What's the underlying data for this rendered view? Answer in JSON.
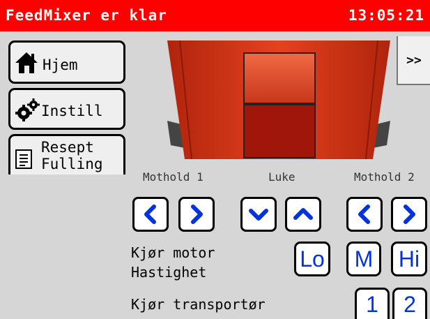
{
  "header": {
    "title": "FeedMixer er klar",
    "time": "13:05:21"
  },
  "sidebar": {
    "items": [
      {
        "label": "Hjem",
        "icon": "home-icon"
      },
      {
        "label": "Instill",
        "icon": "gears-icon"
      },
      {
        "label": "Resept Fulling",
        "icon": "recipe-icon"
      }
    ]
  },
  "next_label": ">>",
  "controls": {
    "mothold1_label": "Mothold 1",
    "luke_label": "Luke",
    "mothold2_label": "Mothold 2"
  },
  "motor": {
    "label_line1": "Kjør motor",
    "label_line2": "Hastighet",
    "speeds": [
      "Lo",
      "M",
      "Hi"
    ]
  },
  "transport": {
    "label": "Kjør transportør",
    "options": [
      "1",
      "2"
    ]
  },
  "colors": {
    "header": "#ff0000",
    "accent_blue": "#0033dd",
    "machine_red": "#d9341a"
  }
}
